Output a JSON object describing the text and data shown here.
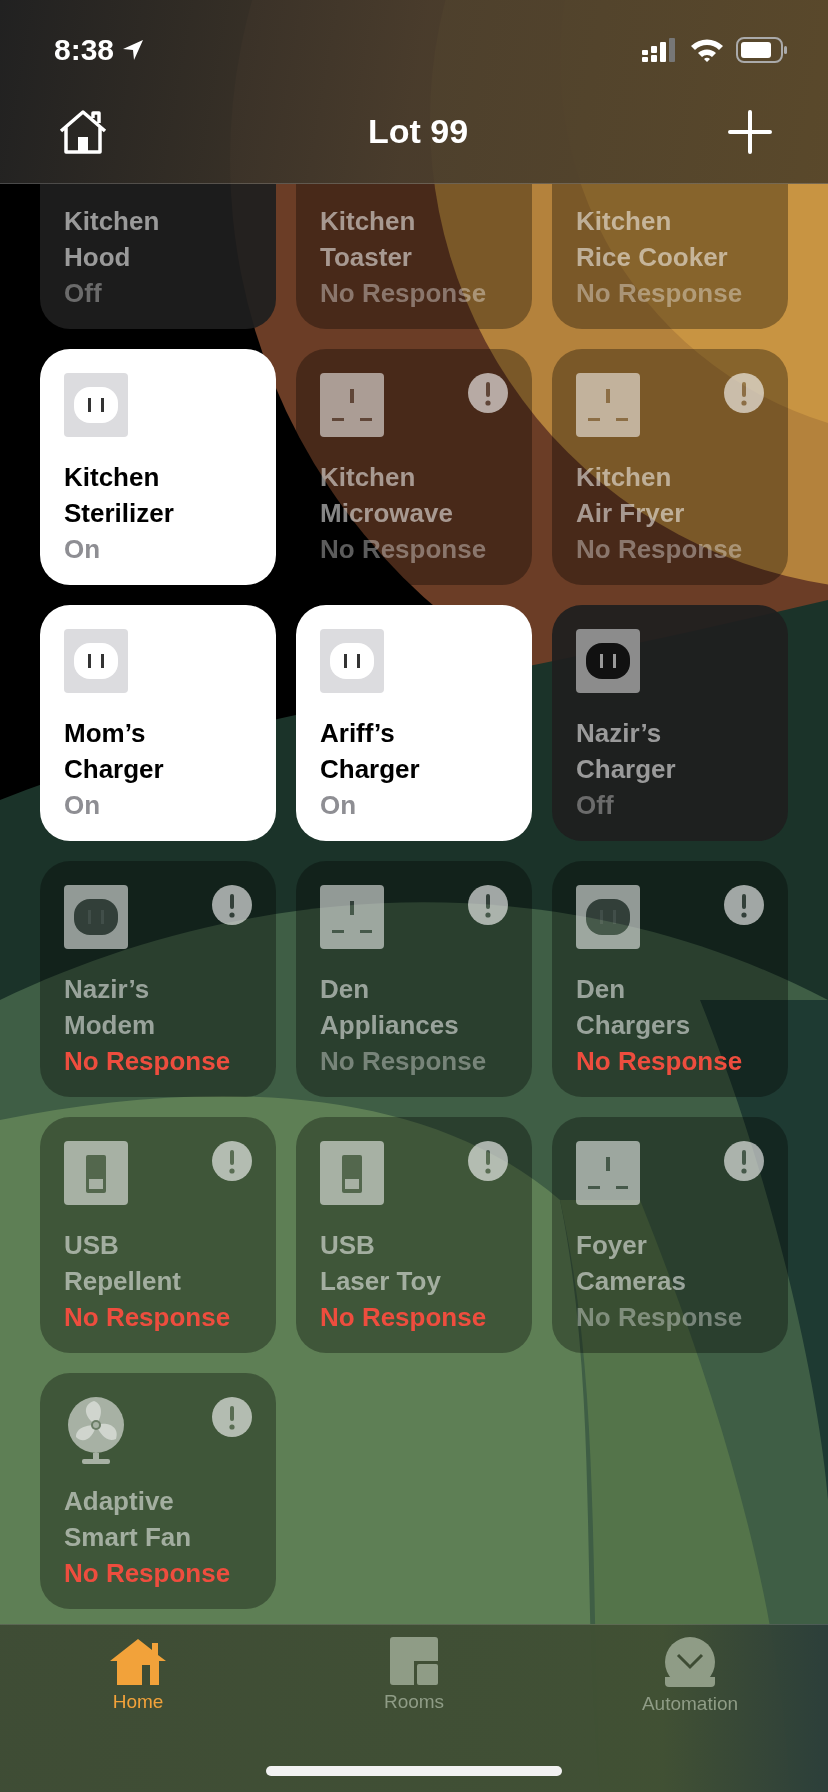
{
  "status_bar": {
    "time": "8:38"
  },
  "nav": {
    "title": "Lot 99"
  },
  "tiles": [
    {
      "name": "Kitchen\nHood",
      "status": "Off",
      "on": false,
      "reachable": true,
      "status_alert": false
    },
    {
      "name": "Kitchen\nToaster",
      "status": "No Response",
      "on": false,
      "reachable": false,
      "status_alert": false
    },
    {
      "name": "Kitchen\nRice Cooker",
      "status": "No Response",
      "on": false,
      "reachable": false,
      "status_alert": false
    },
    {
      "name": "Kitchen\nSterilizer",
      "status": "On",
      "on": true,
      "reachable": true,
      "status_alert": false,
      "warning": false,
      "kind": "outlet_us"
    },
    {
      "name": "Kitchen\nMicrowave",
      "status": "No Response",
      "on": false,
      "reachable": false,
      "status_alert": false,
      "warning": true,
      "kind": "outlet_uk"
    },
    {
      "name": "Kitchen\nAir Fryer",
      "status": "No Response",
      "on": false,
      "reachable": false,
      "status_alert": false,
      "warning": true,
      "kind": "outlet_uk"
    },
    {
      "name": "Mom’s\nCharger",
      "status": "On",
      "on": true,
      "reachable": true,
      "status_alert": false,
      "warning": false,
      "kind": "outlet_us"
    },
    {
      "name": "Ariff’s\nCharger",
      "status": "On",
      "on": true,
      "reachable": true,
      "status_alert": false,
      "warning": false,
      "kind": "outlet_us"
    },
    {
      "name": "Nazir’s\nCharger",
      "status": "Off",
      "on": false,
      "reachable": true,
      "status_alert": false,
      "warning": false,
      "kind": "outlet_us"
    },
    {
      "name": "Nazir’s\nModem",
      "status": "No Response",
      "on": false,
      "reachable": false,
      "status_alert": true,
      "warning": true,
      "kind": "outlet_us"
    },
    {
      "name": "Den\nAppliances",
      "status": "No Response",
      "on": false,
      "reachable": false,
      "status_alert": false,
      "warning": true,
      "kind": "outlet_uk"
    },
    {
      "name": "Den\nChargers",
      "status": "No Response",
      "on": false,
      "reachable": false,
      "status_alert": true,
      "warning": true,
      "kind": "outlet_us"
    },
    {
      "name": "USB\nRepellent",
      "status": "No Response",
      "on": false,
      "reachable": false,
      "status_alert": true,
      "warning": true,
      "kind": "usb"
    },
    {
      "name": "USB\nLaser Toy",
      "status": "No Response",
      "on": false,
      "reachable": false,
      "status_alert": true,
      "warning": true,
      "kind": "usb"
    },
    {
      "name": "Foyer\nCameras",
      "status": "No Response",
      "on": false,
      "reachable": false,
      "status_alert": false,
      "warning": true,
      "kind": "outlet_uk"
    },
    {
      "name": "Adaptive\nSmart Fan",
      "status": "No Response",
      "on": false,
      "reachable": false,
      "status_alert": true,
      "warning": true,
      "kind": "fan"
    }
  ],
  "tab_bar": [
    {
      "label": "Home",
      "kind": "home",
      "selected": true
    },
    {
      "label": "Rooms",
      "kind": "rooms",
      "selected": false
    },
    {
      "label": "Automation",
      "kind": "automation",
      "selected": false
    }
  ]
}
